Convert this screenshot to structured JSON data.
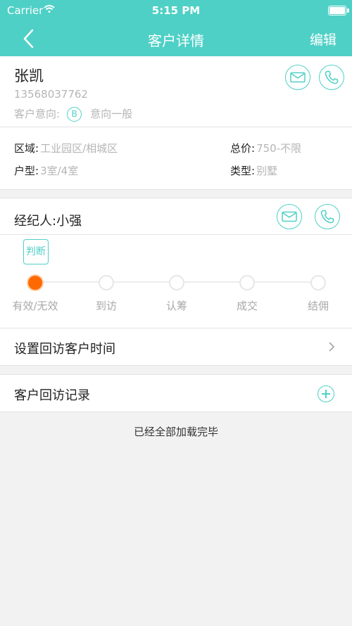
{
  "status_bar": {
    "carrier": "Carrier",
    "time": "5:15 PM"
  },
  "nav": {
    "title": "客户详情",
    "edit_label": "编辑"
  },
  "customer": {
    "name": "张凯",
    "phone": "13568037762",
    "intent_label": "客户意向:",
    "intent_grade": "B",
    "intent_value": "意向一般"
  },
  "details": {
    "area_label": "区域:",
    "area_value": "工业园区/相城区",
    "price_label": "总价:",
    "price_value": "750-不限",
    "layout_label": "户型:",
    "layout_value": "3室/4室",
    "type_label": "类型:",
    "type_value": "别墅"
  },
  "agent": {
    "label": "经纪人:小强"
  },
  "progress": {
    "judge_label": "判断",
    "steps": [
      "有效/无效",
      "到访",
      "认筹",
      "成交",
      "结佣"
    ],
    "current_step": 0
  },
  "callback": {
    "label": "设置回访客户时间"
  },
  "records": {
    "label": "客户回访记录",
    "footer": "已经全部加载完毕"
  },
  "colors": {
    "accent": "#4fd0c6",
    "active_step": "#ff6a00"
  }
}
